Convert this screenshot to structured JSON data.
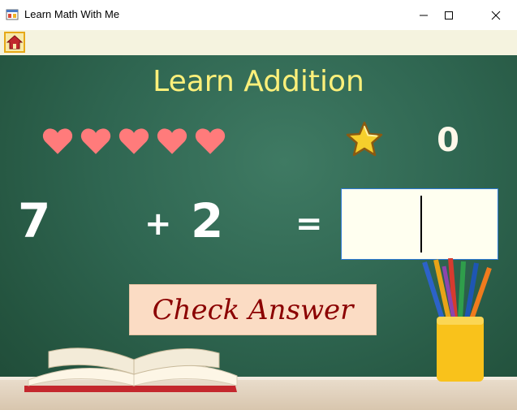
{
  "window": {
    "title": "Learn Math With Me",
    "icon": "app-window-icon",
    "controls": [
      "minimize-icon",
      "maximize-icon",
      "close-icon"
    ]
  },
  "toolbar": {
    "home_icon": "home-icon"
  },
  "game": {
    "heading": "Learn Addition",
    "lives": [
      1,
      1,
      1,
      1,
      1
    ],
    "lives_color": "#ff7b7b",
    "score_icon": "star-icon",
    "score": "0",
    "operand1": "7",
    "operator": "+",
    "operand2": "2",
    "equals": "=",
    "answer_value": "",
    "check_button_label": "Check Answer"
  },
  "colors": {
    "heading": "#fdf07a",
    "button_bg": "#fbdcc4",
    "button_text": "#8b0000",
    "input_border": "#2f7bd6"
  }
}
